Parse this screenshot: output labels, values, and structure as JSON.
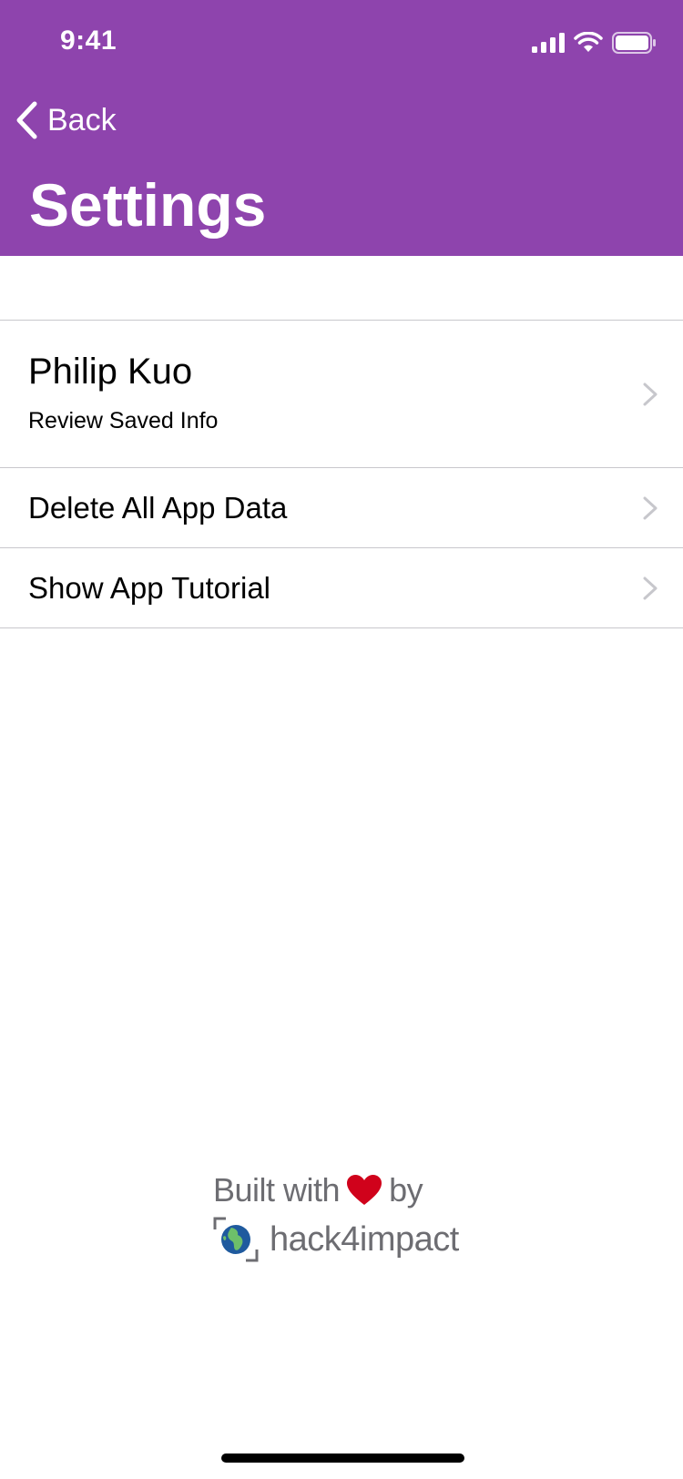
{
  "status_bar": {
    "time": "9:41",
    "icons": [
      "cellular-signal-icon",
      "wifi-icon",
      "battery-icon"
    ]
  },
  "nav": {
    "back_label": "Back",
    "title": "Settings"
  },
  "list": {
    "profile": {
      "name": "Philip Kuo",
      "subtitle": "Review Saved Info"
    },
    "delete_label": "Delete All App Data",
    "tutorial_label": "Show App Tutorial"
  },
  "footer": {
    "built_with": "Built with",
    "by": "by",
    "brand": "hack4impact"
  },
  "colors": {
    "header_bg": "#8e44ad",
    "heart": "#d0021b",
    "footer_text": "#6d6d72",
    "separator": "#c8c7cc",
    "chevron": "#c7c7cc"
  }
}
